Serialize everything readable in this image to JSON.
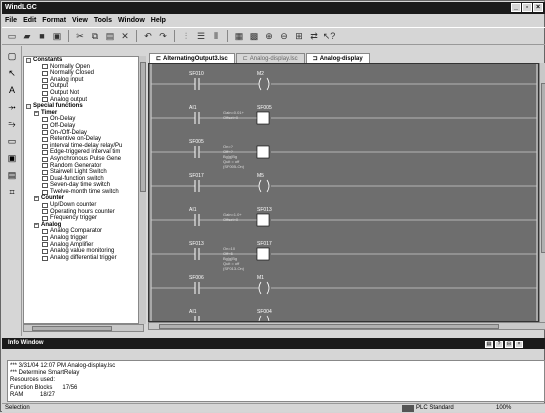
{
  "window": {
    "title": "WindLGC",
    "controls": [
      "_",
      "▫",
      "×"
    ]
  },
  "menu": [
    "File",
    "Edit",
    "Format",
    "View",
    "Tools",
    "Window",
    "Help"
  ],
  "tabs": [
    {
      "label": "AlternatingOutput3.lsc",
      "state": "active"
    },
    {
      "label": "Analog-display.lsc",
      "state": "inactive"
    },
    {
      "label": "Analog-display",
      "state": "active"
    }
  ],
  "tree": [
    {
      "label": "Constants",
      "kind": "cat"
    },
    {
      "label": "Normally Open",
      "kind": "item"
    },
    {
      "label": "Normally Closed",
      "kind": "item"
    },
    {
      "label": "Analog input",
      "kind": "item"
    },
    {
      "label": "Output",
      "kind": "item"
    },
    {
      "label": "Output Not",
      "kind": "item"
    },
    {
      "label": "Analog output",
      "kind": "item"
    },
    {
      "label": "Special functions",
      "kind": "cat"
    },
    {
      "label": "Timer",
      "kind": "cat"
    },
    {
      "label": "On-Delay",
      "kind": "item"
    },
    {
      "label": "Off-Delay",
      "kind": "item"
    },
    {
      "label": "On-/Off-Delay",
      "kind": "item"
    },
    {
      "label": "Retentive on-Delay",
      "kind": "item"
    },
    {
      "label": "interval time-delay relay/Pu",
      "kind": "item"
    },
    {
      "label": "Edge-triggered interval tim",
      "kind": "item"
    },
    {
      "label": "Asynchronous Pulse Gene",
      "kind": "item"
    },
    {
      "label": "Random Generator",
      "kind": "item"
    },
    {
      "label": "Stairwell Light Switch",
      "kind": "item"
    },
    {
      "label": "Dual-function switch",
      "kind": "item"
    },
    {
      "label": "Seven-day time switch",
      "kind": "item"
    },
    {
      "label": "Twelve-month time switch",
      "kind": "item"
    },
    {
      "label": "Counter",
      "kind": "cat"
    },
    {
      "label": "Up/Down counter",
      "kind": "item"
    },
    {
      "label": "Operating hours counter",
      "kind": "item"
    },
    {
      "label": "Frequency trigger",
      "kind": "item"
    },
    {
      "label": "Analog",
      "kind": "cat"
    },
    {
      "label": "Analog Comparator",
      "kind": "item"
    },
    {
      "label": "Analog trigger",
      "kind": "item"
    },
    {
      "label": "Analog Amplifier",
      "kind": "item"
    },
    {
      "label": "Analog value monitoring",
      "kind": "item"
    },
    {
      "label": "Analog differential trigger",
      "kind": "item"
    }
  ],
  "ladder": [
    {
      "a": "SF010",
      "b": "M2"
    },
    {
      "a": "AI1",
      "b": "SF005",
      "note": "Gain=0.01+\nOffset=0"
    },
    {
      "a": "SF005",
      "b": "",
      "note": "On=?\nOff=?\nBg|g|Bg\nQuit = off\n(SF005-On)"
    },
    {
      "a": "SF017",
      "b": "M5"
    },
    {
      "a": "AI1",
      "b": "SF013",
      "note": "Gain=1.0+\nOffset=0"
    },
    {
      "a": "SF013",
      "b": "SF017",
      "note": "On=10\nOff=5\nBg|g|Bg\nQuit = off\n(SF013-On)"
    },
    {
      "a": "SF006",
      "b": "M1"
    },
    {
      "a": "AI1",
      "b": "SF004"
    }
  ],
  "info": {
    "title": "Info Window",
    "lines": [
      "*** 3/31/04 12:07 PM Analog-display.lsc",
      "*** Determine SmartRelay",
      "Resources used:",
      "Function Blocks      17/56",
      "RAM          18/27"
    ]
  },
  "status": {
    "left": "Selection",
    "device": "PLC Standard",
    "zoom": "100%"
  }
}
